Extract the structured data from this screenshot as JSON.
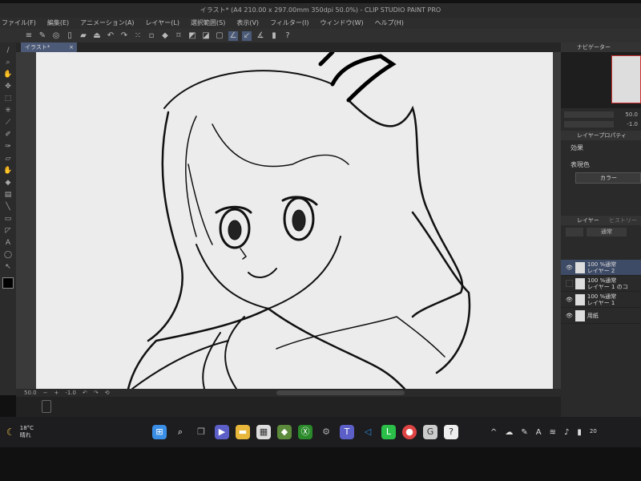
{
  "window": {
    "title": "イラスト* (A4 210.00 x 297.00mm 350dpi 50.0%) - CLIP STUDIO PAINT PRO"
  },
  "menu": [
    "ファイル(F)",
    "編集(E)",
    "アニメーション(A)",
    "レイヤー(L)",
    "選択範囲(S)",
    "表示(V)",
    "フィルター(I)",
    "ウィンドウ(W)",
    "ヘルプ(H)"
  ],
  "tab": {
    "label": "イラスト*"
  },
  "navigator": {
    "title": "ナビゲーター",
    "zoom": "50.0",
    "rotate": "-1.0"
  },
  "layer_property": {
    "title": "レイヤープロパティ",
    "effect_label": "効果",
    "color_label": "表現色",
    "color_button": "カラー"
  },
  "layers_panel": {
    "title": "レイヤー",
    "history_tab": "ヒストリー",
    "blend_mode": "通常",
    "layers": [
      {
        "mode": "100 %通常",
        "name": "レイヤー 2",
        "visible": true,
        "selected": true
      },
      {
        "mode": "100 %通常",
        "name": "レイヤー 1 のコ",
        "visible": false,
        "selected": false
      },
      {
        "mode": "100 %通常",
        "name": "レイヤー 1",
        "visible": true,
        "selected": false
      },
      {
        "mode": "",
        "name": "用紙",
        "visible": true,
        "selected": false
      }
    ]
  },
  "statusbar": {
    "zoom": "50.0",
    "rotation": "-1.0"
  },
  "taskbar": {
    "weather_temp": "18°C",
    "weather_text": "晴れ",
    "clock": "20"
  },
  "colors": {
    "accent": "#4c5a78",
    "canvas": "#ececec"
  }
}
